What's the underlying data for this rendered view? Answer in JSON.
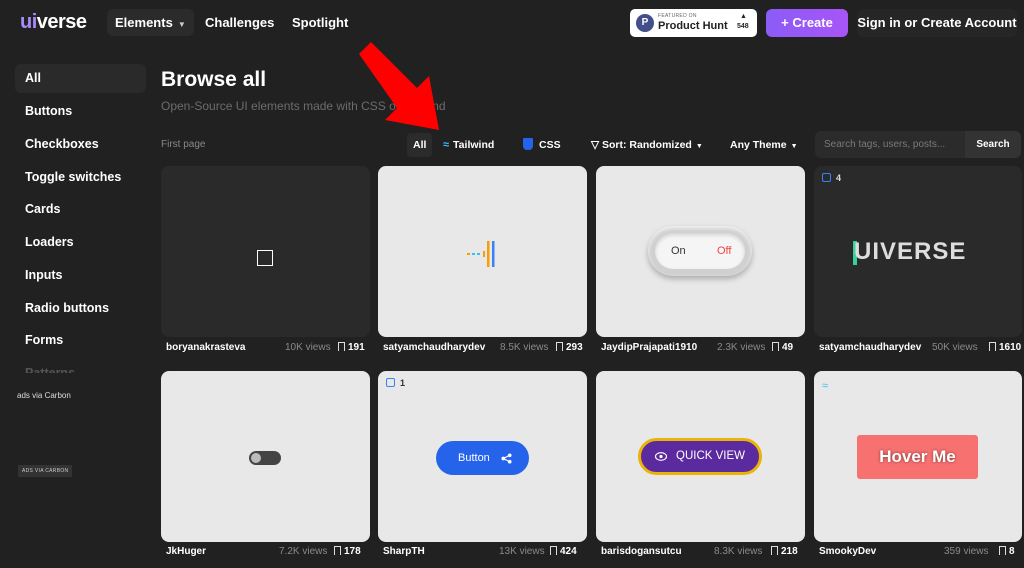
{
  "nav": {
    "logo_ui": "ui",
    "logo_rest": "verse",
    "elements": "Elements",
    "challenges": "Challenges",
    "spotlight": "Spotlight",
    "product_hunt": {
      "small": "FEATURED ON",
      "name": "Product Hunt",
      "count": "548"
    },
    "create": "Create",
    "signin": "Sign in or Create Account"
  },
  "sidebar": {
    "items": [
      {
        "label": "All"
      },
      {
        "label": "Buttons"
      },
      {
        "label": "Checkboxes"
      },
      {
        "label": "Toggle switches"
      },
      {
        "label": "Cards"
      },
      {
        "label": "Loaders"
      },
      {
        "label": "Inputs"
      },
      {
        "label": "Radio buttons"
      },
      {
        "label": "Forms"
      },
      {
        "label": "Patterns"
      }
    ],
    "ads_image_alt": "ads via Carbon",
    "ads_badge": "ADS VIA CARBON"
  },
  "main": {
    "title": "Browse all",
    "subtitle": "Open-Source UI elements made with CSS or Tailwind",
    "first_page": "First page",
    "filters": {
      "all": "All",
      "tailwind": "Tailwind",
      "css": "CSS",
      "sort": "Sort: Randomized",
      "theme": "Any Theme"
    },
    "search": {
      "placeholder": "Search tags, users, posts...",
      "button": "Search"
    }
  },
  "cards": [
    {
      "author": "boryanakrasteva",
      "views": "10K views",
      "bookmarks": "191"
    },
    {
      "author": "satyamchaudharydev",
      "views": "8.5K views",
      "bookmarks": "293"
    },
    {
      "author": "JaydipPrajapati1910",
      "views": "2.3K views",
      "bookmarks": "49",
      "on": "On",
      "off": "Off"
    },
    {
      "author": "satyamchaudharydev",
      "views": "50K views",
      "bookmarks": "1610",
      "badge": "4",
      "text": "UIVERSE"
    },
    {
      "author": "JkHuger",
      "views": "7.2K views",
      "bookmarks": "178"
    },
    {
      "author": "SharpTH",
      "views": "13K views",
      "bookmarks": "424",
      "badge": "1",
      "button": "Button"
    },
    {
      "author": "barisdogansutcu",
      "views": "8.3K views",
      "bookmarks": "218",
      "button": "QUICK VIEW"
    },
    {
      "author": "SmookyDev",
      "views": "359 views",
      "bookmarks": "8",
      "button": "Hover Me"
    }
  ]
}
